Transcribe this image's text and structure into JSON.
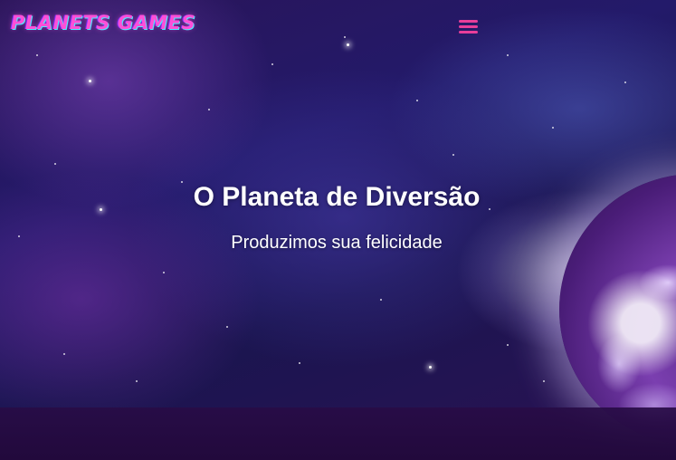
{
  "header": {
    "logo_text": "PLANETS GAMES",
    "menu_icon": "hamburger-menu-icon"
  },
  "hero": {
    "title": "O Planeta de Diversão",
    "subtitle": "Produzimos sua felicidade"
  },
  "colors": {
    "logo": "#ff4fd8",
    "menu_icon": "#e83e9a",
    "text": "#ffffff"
  }
}
